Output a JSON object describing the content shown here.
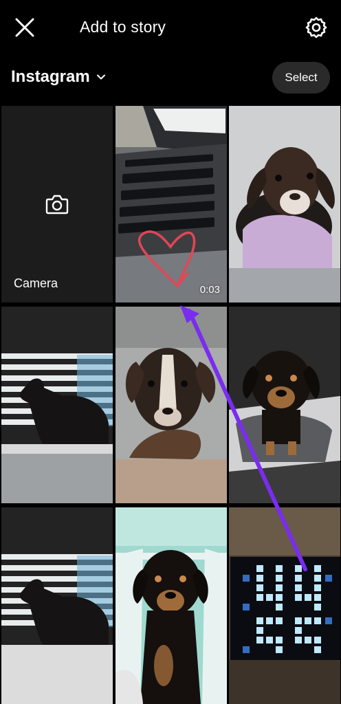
{
  "header": {
    "title": "Add to story",
    "close_icon": "close-icon",
    "settings_icon": "gear-icon"
  },
  "source": {
    "label": "Instagram",
    "dropdown_icon": "chevron-down-icon",
    "select_label": "Select"
  },
  "grid": {
    "camera_label": "Camera",
    "camera_icon": "camera-icon",
    "items": [
      {
        "type": "video",
        "subject": "laptop keyboard with drawn heart",
        "duration": "0:03"
      },
      {
        "type": "photo",
        "subject": "puppy in lilac shirt"
      },
      {
        "type": "photo",
        "subject": "dog by window blinds"
      },
      {
        "type": "photo",
        "subject": "puppy with hand"
      },
      {
        "type": "photo",
        "subject": "dachshund on mat"
      },
      {
        "type": "photo",
        "subject": "dog by window blinds"
      },
      {
        "type": "photo",
        "subject": "dachshund by railing"
      },
      {
        "type": "photo",
        "subject": "LED pixel clock"
      }
    ]
  },
  "annotation": {
    "color": "#7a2cf0"
  }
}
